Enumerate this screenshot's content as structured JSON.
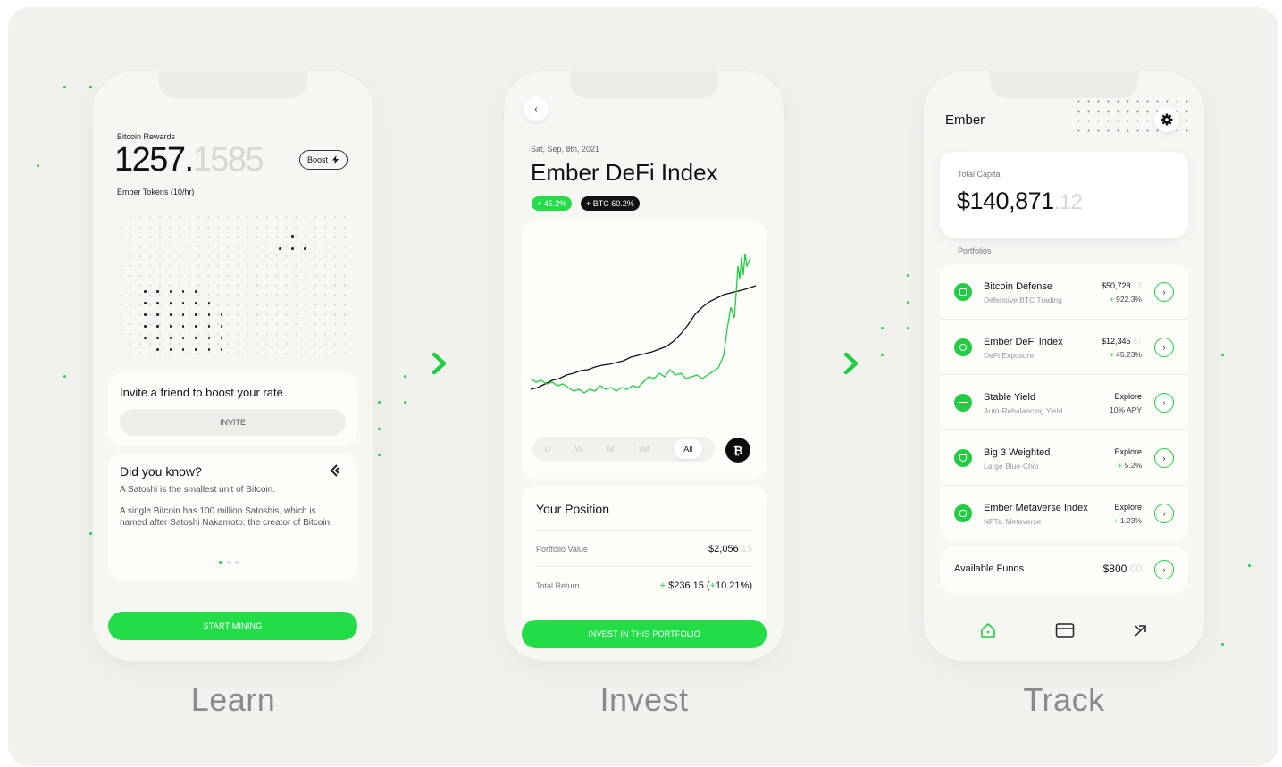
{
  "captions": {
    "learn": "Learn",
    "invest": "Invest",
    "track": "Track"
  },
  "colors": {
    "accent": "#22dc48",
    "background": "#f1f1ee"
  },
  "learn_screen": {
    "rewards_label": "Bitcoin Rewards",
    "rewards_int": "1257.",
    "rewards_frac": "1585",
    "boost_label": "Boost",
    "rate_label": "Ember Tokens (10/hr)",
    "invite_title": "Invite a friend to boost your rate",
    "invite_button": "INVITE",
    "dyk_title": "Did you know?",
    "dyk_p1": "A Satoshi is the smallest unit of Bitcoin.",
    "dyk_p2": "A single Bitcoin has 100 million Satoshis, which is named after Satoshi Nakamoto: the creator of Bitcoin",
    "cta": "START MINING"
  },
  "invest_screen": {
    "date": "Sat, Sep, 8th, 2021",
    "title": "Ember DeFi Index",
    "pill_green": "+ 45.2%",
    "pill_dark": "+ BTC 60.2%",
    "ranges": [
      "D",
      "W",
      "M",
      "3M",
      "All"
    ],
    "btc_icon": "₿",
    "position_title": "Your Position",
    "portfolio_value_label": "Portfolio Value",
    "portfolio_value": "$2,056",
    "portfolio_value_frac": ".15",
    "total_return_label": "Total Return",
    "total_return_sign": "+",
    "total_return": "$236.15",
    "total_return_pct_open": "(",
    "total_return_pct_sign": "+",
    "total_return_pct": "10.21%)",
    "cta": "INVEST IN THIS PORTFOLIO"
  },
  "track_screen": {
    "title": "Ember",
    "total_capital_label": "Total Capital",
    "total_capital": "$140,871",
    "total_capital_frac": ".12",
    "portfolios_label": "Portfolios",
    "portfolios": [
      {
        "name": "Bitcoin Defense",
        "sub": "Defensive BTC Trading",
        "value": "$50,728",
        "value_frac": ".17",
        "change_sign": "+",
        "change": "922.3%"
      },
      {
        "name": "Ember DeFi Index",
        "sub": "DeFi Exposure",
        "value": "$12,345",
        "value_frac": ".67",
        "change_sign": "+",
        "change": "45.23%"
      },
      {
        "name": "Stable Yield",
        "sub": "Auto-Rebalancing Yield",
        "value": "Explore",
        "value_frac": "",
        "change_sign": "",
        "change": "10% APY"
      },
      {
        "name": "Big 3 Weighted",
        "sub": "Large Blue-Chip",
        "value": "Explore",
        "value_frac": "",
        "change_sign": "+",
        "change": "5.2%"
      },
      {
        "name": "Ember Metaverse Index",
        "sub": "NFTs, Metaverse",
        "value": "Explore",
        "value_frac": "",
        "change_sign": "+",
        "change": "1.23%"
      }
    ],
    "available_funds_label": "Available Funds",
    "available_funds": "$800",
    "available_funds_frac": ".00"
  }
}
